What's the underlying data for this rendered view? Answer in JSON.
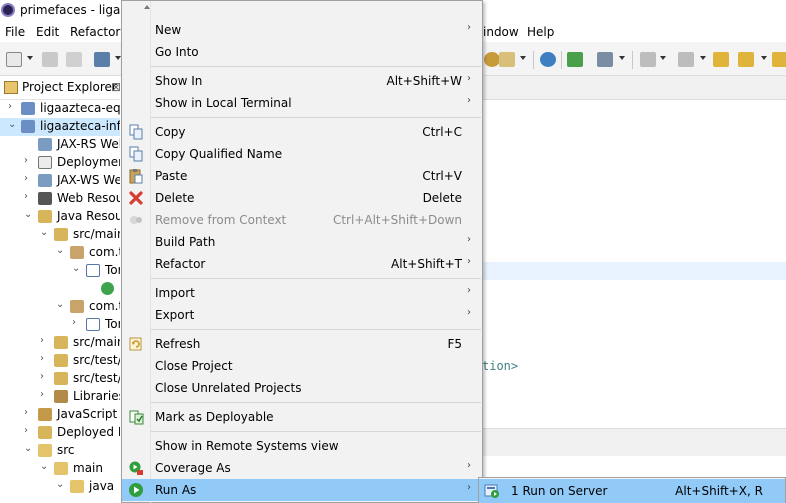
{
  "window": {
    "title": "primefaces - ligaaz"
  },
  "menubar": {
    "items": [
      "File",
      "Edit",
      "Refactor",
      "indow",
      "Help"
    ]
  },
  "explorer": {
    "title": "Project Explorer",
    "close_glyph": "⊠",
    "rows": [
      {
        "label": "ligaazteca-equi",
        "chevron": "›"
      },
      {
        "label": "ligaazteca-info",
        "chevron": "⌄"
      },
      {
        "label": "JAX-RS Web",
        "chevron": ""
      },
      {
        "label": "Deploymen",
        "chevron": "›"
      },
      {
        "label": "JAX-WS Wel",
        "chevron": "›"
      },
      {
        "label": "Web Resour",
        "chevron": "›"
      },
      {
        "label": "Java Resour",
        "chevron": "⌄"
      },
      {
        "label": "src/main",
        "chevron": "⌄"
      },
      {
        "label": "com.t",
        "chevron": "⌄"
      },
      {
        "label": "Tor",
        "chevron": "⌄"
      },
      {
        "label": "C",
        "chevron": "›"
      },
      {
        "label": "com.t",
        "chevron": "⌄"
      },
      {
        "label": "Tor",
        "chevron": "›"
      },
      {
        "label": "src/main",
        "chevron": "›"
      },
      {
        "label": "src/test/j",
        "chevron": "›"
      },
      {
        "label": "src/test/r",
        "chevron": "›"
      },
      {
        "label": "Libraries",
        "chevron": "›"
      },
      {
        "label": "JavaScript R",
        "chevron": "›"
      },
      {
        "label": "Deployed Re",
        "chevron": "›"
      },
      {
        "label": "src",
        "chevron": "⌄"
      },
      {
        "label": "main",
        "chevron": "⌄"
      },
      {
        "label": "java",
        "chevron": "⌄"
      }
    ]
  },
  "editor": {
    "code_fragment": "tion>"
  },
  "context_menu": {
    "scroll_up_glyph": "▲",
    "items": [
      {
        "label": "New",
        "shortcut": "",
        "submenu": "›",
        "icon": "",
        "disabled": false
      },
      {
        "label": "Go Into",
        "shortcut": "",
        "submenu": "",
        "icon": "",
        "disabled": false
      },
      {
        "label": "Show In",
        "shortcut": "Alt+Shift+W",
        "submenu": "›",
        "icon": "",
        "disabled": false
      },
      {
        "label": "Show in Local Terminal",
        "shortcut": "",
        "submenu": "›",
        "icon": "",
        "disabled": false
      },
      {
        "label": "Copy",
        "shortcut": "Ctrl+C",
        "submenu": "",
        "icon": "copy-icon",
        "disabled": false
      },
      {
        "label": "Copy Qualified Name",
        "shortcut": "",
        "submenu": "",
        "icon": "copy-qualified-icon",
        "disabled": false
      },
      {
        "label": "Paste",
        "shortcut": "Ctrl+V",
        "submenu": "",
        "icon": "paste-icon",
        "disabled": false
      },
      {
        "label": "Delete",
        "shortcut": "Delete",
        "submenu": "",
        "icon": "delete-icon",
        "disabled": false
      },
      {
        "label": "Remove from Context",
        "shortcut": "Ctrl+Alt+Shift+Down",
        "submenu": "",
        "icon": "remove-context-icon",
        "disabled": true
      },
      {
        "label": "Build Path",
        "shortcut": "",
        "submenu": "›",
        "icon": "",
        "disabled": false
      },
      {
        "label": "Refactor",
        "shortcut": "Alt+Shift+T",
        "submenu": "›",
        "icon": "",
        "disabled": false
      },
      {
        "label": "Import",
        "shortcut": "",
        "submenu": "›",
        "icon": "",
        "disabled": false
      },
      {
        "label": "Export",
        "shortcut": "",
        "submenu": "›",
        "icon": "",
        "disabled": false
      },
      {
        "label": "Refresh",
        "shortcut": "F5",
        "submenu": "",
        "icon": "refresh-icon",
        "disabled": false
      },
      {
        "label": "Close Project",
        "shortcut": "",
        "submenu": "",
        "icon": "",
        "disabled": false
      },
      {
        "label": "Close Unrelated Projects",
        "shortcut": "",
        "submenu": "",
        "icon": "",
        "disabled": false
      },
      {
        "label": "Mark as Deployable",
        "shortcut": "",
        "submenu": "",
        "icon": "deployable-icon",
        "disabled": false
      },
      {
        "label": "Show in Remote Systems view",
        "shortcut": "",
        "submenu": "",
        "icon": "",
        "disabled": false
      },
      {
        "label": "Coverage As",
        "shortcut": "",
        "submenu": "›",
        "icon": "coverage-icon",
        "disabled": false
      },
      {
        "label": "Run As",
        "shortcut": "",
        "submenu": "›",
        "icon": "run-icon",
        "disabled": false,
        "active": true
      }
    ]
  },
  "submenu": {
    "item": {
      "label": "1 Run on Server",
      "shortcut": "Alt+Shift+X, R",
      "icon": "server-icon"
    }
  },
  "colors": {
    "menu_bg": "#f2f2f2",
    "highlight": "#91c9f7",
    "disabled_text": "#8c8c8c",
    "delete_red": "#d83b2f",
    "run_green": "#2e9e3e"
  }
}
